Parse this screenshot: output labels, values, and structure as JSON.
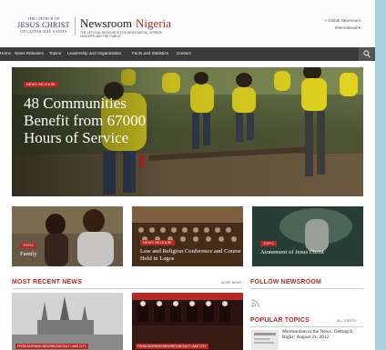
{
  "header": {
    "logo_top": "THE CHURCH OF",
    "logo_main": "JESUS CHRIST",
    "logo_bottom": "OF LATTER-DAY SAINTS",
    "newsroom": "Newsroom",
    "country": "Nigeria",
    "subtitle": "THE OFFICIAL RESOURCE FOR NEWS MEDIA, OPINION LEADERS AND THE PUBLIC",
    "global_link": "< Global Newsroom",
    "international_link": "International ▾"
  },
  "nav": {
    "items": [
      "Home",
      "News Releases",
      "Topics",
      "Leadership and Organization",
      "Facts and Statistics",
      "Contact"
    ]
  },
  "hero": {
    "badge": "NEWS RELEASE",
    "title": "48 Communities Benefit from 67000 Hours of Service"
  },
  "cards": [
    {
      "badge": "TOPIC",
      "title": "Family"
    },
    {
      "badge": "NEWS RELEASE",
      "title": "Law and Religion Conference and Course Held in Lagos"
    },
    {
      "badge": "TOPIC",
      "title": "Atonement of Jesus Christ"
    }
  ],
  "sections": {
    "most_recent": "MOST RECENT NEWS",
    "more_link": "MORE NEWS ›",
    "follow": "FOLLOW NEWSROOM",
    "popular": "POPULAR TOPICS",
    "all_topics": "ALL TOPICS ›"
  },
  "news_captions": [
    "FROM MORMON NEWSROOM SALT LAKE CITY",
    "FROM MORMON NEWSROOM SALT LAKE CITY"
  ],
  "popular_item": "Mormonism in the News: Getting It Right | August 21, 2012"
}
